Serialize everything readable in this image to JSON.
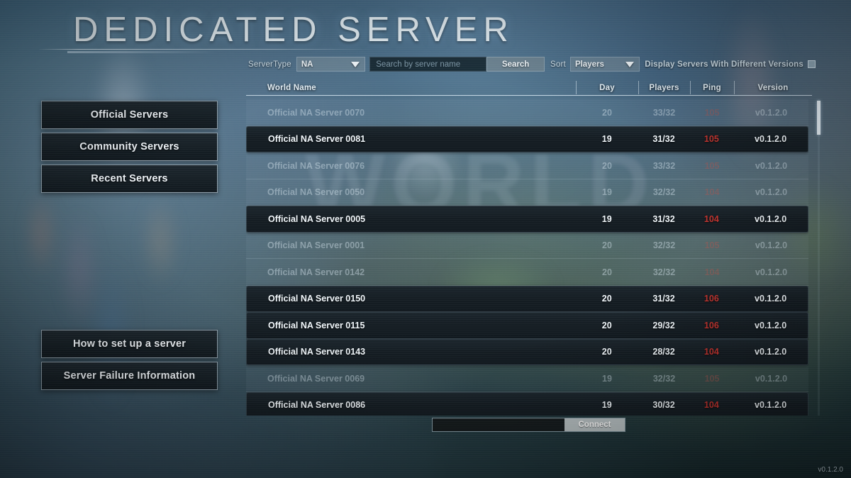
{
  "page": {
    "title": "DEDICATED SERVER",
    "watermark": "WORLD",
    "version_corner": "v0.1.2.0"
  },
  "toolbar": {
    "server_type_label": "ServerType",
    "server_type_value": "NA",
    "server_type_options": [
      "NA"
    ],
    "search_placeholder": "Search by server name",
    "search_value": "",
    "search_button": "Search",
    "sort_label": "Sort",
    "sort_value": "Players",
    "sort_options": [
      "Players"
    ],
    "different_versions_label": "Display Servers With Different Versions",
    "different_versions_checked": true,
    "caret_icon": "chevron-down-icon"
  },
  "sidebar": {
    "items": [
      {
        "label": "Official Servers"
      },
      {
        "label": "Community Servers"
      },
      {
        "label": "Recent Servers"
      }
    ],
    "help_items": [
      {
        "label": "How to set up a server"
      },
      {
        "label": "Server Failure Information"
      }
    ]
  },
  "table": {
    "columns": [
      {
        "key": "name",
        "label": "World Name"
      },
      {
        "key": "day",
        "label": "Day"
      },
      {
        "key": "players",
        "label": "Players"
      },
      {
        "key": "ping",
        "label": "Ping"
      },
      {
        "key": "version",
        "label": "Version"
      }
    ],
    "rows": [
      {
        "name": "Official NA Server 0070",
        "day": "20",
        "players": "33/32",
        "ping": "105",
        "version": "v0.1.2.0",
        "state": "full"
      },
      {
        "name": "Official NA Server 0081",
        "day": "19",
        "players": "31/32",
        "ping": "105",
        "version": "v0.1.2.0",
        "state": "joinable"
      },
      {
        "name": "Official NA Server 0076",
        "day": "20",
        "players": "33/32",
        "ping": "105",
        "version": "v0.1.2.0",
        "state": "full"
      },
      {
        "name": "Official NA Server 0050",
        "day": "19",
        "players": "32/32",
        "ping": "104",
        "version": "v0.1.2.0",
        "state": "full"
      },
      {
        "name": "Official NA Server 0005",
        "day": "19",
        "players": "31/32",
        "ping": "104",
        "version": "v0.1.2.0",
        "state": "joinable"
      },
      {
        "name": "Official NA Server 0001",
        "day": "20",
        "players": "32/32",
        "ping": "105",
        "version": "v0.1.2.0",
        "state": "full"
      },
      {
        "name": "Official NA Server 0142",
        "day": "20",
        "players": "32/32",
        "ping": "104",
        "version": "v0.1.2.0",
        "state": "full"
      },
      {
        "name": "Official NA Server 0150",
        "day": "20",
        "players": "31/32",
        "ping": "106",
        "version": "v0.1.2.0",
        "state": "joinable"
      },
      {
        "name": "Official NA Server 0115",
        "day": "20",
        "players": "29/32",
        "ping": "106",
        "version": "v0.1.2.0",
        "state": "joinable"
      },
      {
        "name": "Official NA Server 0143",
        "day": "20",
        "players": "28/32",
        "ping": "104",
        "version": "v0.1.2.0",
        "state": "joinable"
      },
      {
        "name": "Official NA Server 0069",
        "day": "19",
        "players": "32/32",
        "ping": "105",
        "version": "v0.1.2.0",
        "state": "full"
      },
      {
        "name": "Official NA Server 0086",
        "day": "19",
        "players": "30/32",
        "ping": "104",
        "version": "v0.1.2.0",
        "state": "joinable"
      }
    ],
    "scroll_position": "top"
  },
  "connect": {
    "input_value": "",
    "button_label": "Connect"
  },
  "colors": {
    "ping_red": "#c1332e",
    "row_dark": "#161f25",
    "text_light": "#f2f8fc",
    "accent_line": "#e1f0fa"
  }
}
